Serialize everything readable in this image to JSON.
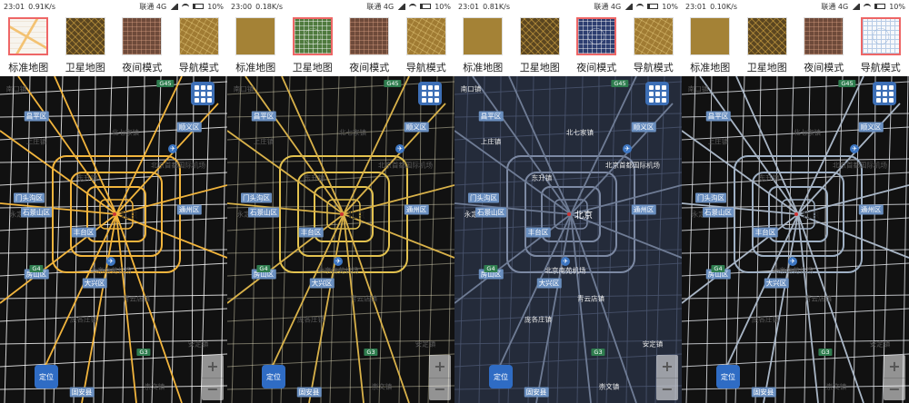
{
  "mode_labels": {
    "standard": "标准地图",
    "satellite": "卫星地图",
    "night": "夜间模式",
    "navigation": "导航模式"
  },
  "panels": [
    {
      "id": "standard",
      "status": {
        "time": "23:01",
        "speed": "0.91K/s",
        "carrier": "联通 4G",
        "battery": "10%"
      },
      "selected_thumb": 0,
      "map_style": "standard"
    },
    {
      "id": "satellite",
      "status": {
        "time": "23:00",
        "speed": "0.18K/s",
        "carrier": "联通 4G",
        "battery": "10%"
      },
      "selected_thumb": 1,
      "map_style": "satellite"
    },
    {
      "id": "night",
      "status": {
        "time": "23:01",
        "speed": "0.81K/s",
        "carrier": "联通 4G",
        "battery": "10%"
      },
      "selected_thumb": 2,
      "map_style": "night"
    },
    {
      "id": "navigation",
      "status": {
        "time": "23:01",
        "speed": "0.10K/s",
        "carrier": "联通 4G",
        "battery": "10%"
      },
      "selected_thumb": 3,
      "map_style": "navigation"
    }
  ],
  "map_labels": {
    "city": "北京",
    "airport_capital": "北京首都国际机场",
    "airport_nanyuan": "北京南苑机场",
    "town_beiqijia": "北七家镇",
    "town_shangzhuang": "上庄镇",
    "town_dongsheng": "东升镇",
    "town_yongding": "永定镇",
    "town_qingyundian": "青云店镇",
    "town_panggezhuang": "庞各庄镇",
    "town_anding": "安定镇",
    "town_chongwen": "崇文镇",
    "district_changping": "昌平区",
    "district_shunyi": "顺义区",
    "district_mentougou": "门头沟区",
    "district_shijingshan": "石景山区",
    "district_fengtai": "丰台区",
    "district_tongzhou": "通州区",
    "district_fangshan": "房山区",
    "district_daxing": "大兴区",
    "district_nankou": "南口镇",
    "district_guan": "固安县",
    "road_g45": "G45",
    "road_g4": "G4",
    "road_g3": "G3"
  },
  "controls": {
    "locate_label": "定位",
    "zoom_in": "+",
    "zoom_out": "−"
  },
  "colors": {
    "accent": "#2f6cc4",
    "selected_border": "#e66666"
  }
}
